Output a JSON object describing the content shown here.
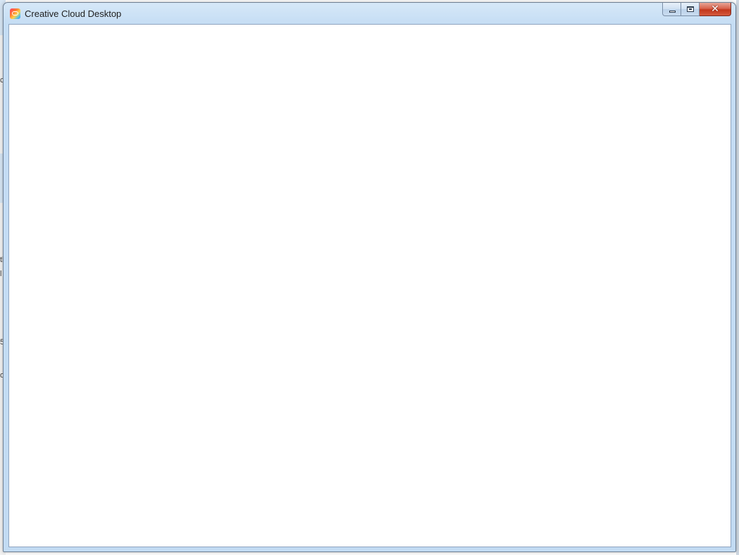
{
  "window": {
    "title": "Creative Cloud Desktop",
    "app_icon": "creative-cloud-icon"
  },
  "controls": {
    "minimize_icon": "minimize-icon",
    "maximize_icon": "maximize-icon",
    "close_icon": "close-icon",
    "close_glyph": "✕"
  },
  "background_window": {
    "fragments": [
      "c",
      "tl",
      "l",
      "5",
      "o"
    ]
  },
  "colors": {
    "titlebar": "#c5ddf4",
    "close_button": "#c2371c",
    "client_background": "#ffffff"
  }
}
